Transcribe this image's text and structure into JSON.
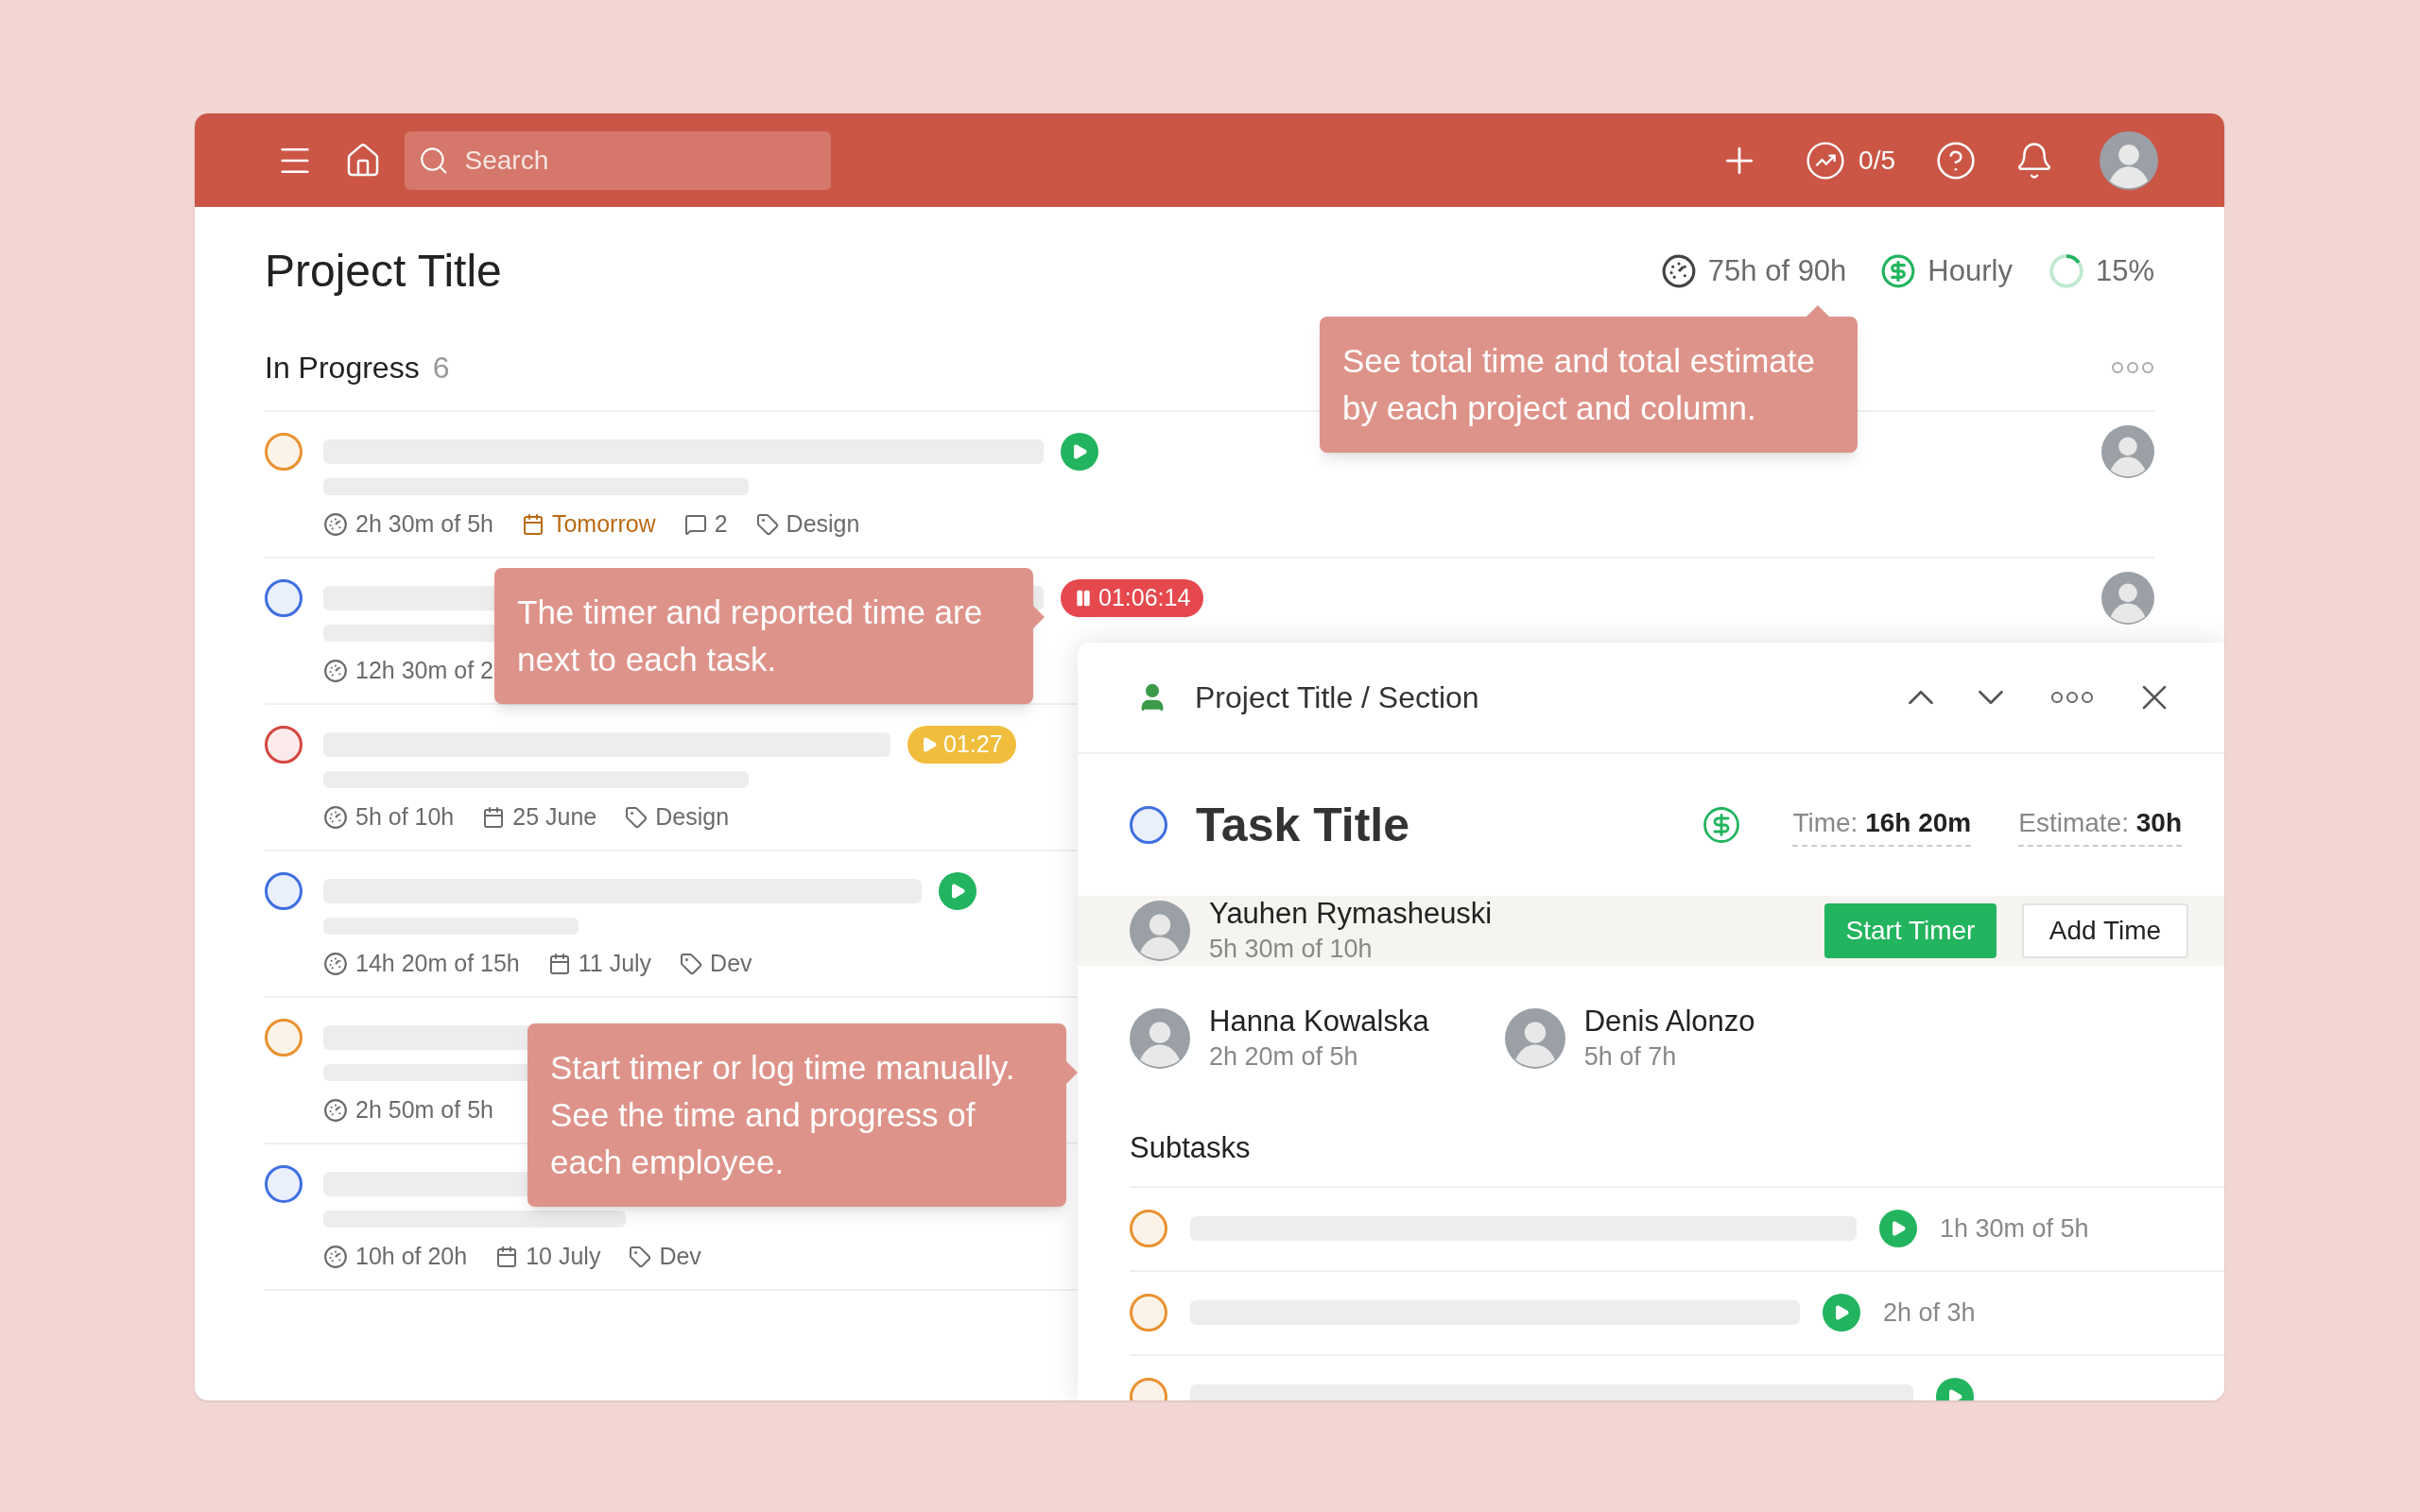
{
  "topbar": {
    "search": {
      "placeholder": "Search"
    },
    "goals": "0/5"
  },
  "project": {
    "title": "Project Title",
    "total_time": "75h of 90h",
    "billing": "Hourly",
    "progress": {
      "label": "15%",
      "level": 0.15
    }
  },
  "section": {
    "title": "In Progress",
    "count": "6"
  },
  "tasks": [
    {
      "color": "#e8922f",
      "timer": {
        "kind": "play"
      },
      "has_avatar": true,
      "meta": [
        {
          "kind": "time",
          "text": "2h 30m of 5h"
        },
        {
          "kind": "date",
          "text": "Tomorrow",
          "due_soon": true
        },
        {
          "kind": "comments",
          "text": "2"
        },
        {
          "kind": "tag",
          "text": "Design"
        }
      ]
    },
    {
      "color": "#3f6fe0",
      "timer": {
        "kind": "running",
        "time": "01:06:14"
      },
      "has_avatar": true,
      "meta": [
        {
          "kind": "time",
          "text": "12h 30m of 2"
        }
      ]
    },
    {
      "color": "#d4463f",
      "timer": {
        "kind": "paused",
        "time": "01:27"
      },
      "meta": [
        {
          "kind": "time",
          "text": "5h of 10h"
        },
        {
          "kind": "date",
          "text": "25 June",
          "due_soon": false
        },
        {
          "kind": "tag",
          "text": "Design"
        }
      ]
    },
    {
      "color": "#3f6fe0",
      "timer": {
        "kind": "play"
      },
      "meta": [
        {
          "kind": "time",
          "text": "14h 20m of 15h"
        },
        {
          "kind": "date",
          "text": "11 July",
          "due_soon": false
        },
        {
          "kind": "tag",
          "text": "Dev"
        }
      ]
    },
    {
      "color": "#e8922f",
      "meta": [
        {
          "kind": "time",
          "text": "2h 50m of 5h"
        }
      ]
    },
    {
      "color": "#3f6fe0",
      "meta": [
        {
          "kind": "time",
          "text": "10h of 20h"
        },
        {
          "kind": "date",
          "text": "10 July",
          "due_soon": false
        },
        {
          "kind": "tag",
          "text": "Dev"
        }
      ]
    }
  ],
  "panel": {
    "breadcrumb": "Project Title / Section",
    "task": {
      "title": "Task Title",
      "color": "#3f6fe0",
      "billable": true,
      "time_label": "Time:",
      "time": "16h 20m",
      "estimate_label": "Estimate:",
      "estimate": "30h"
    },
    "assignees": [
      {
        "name": "Yauhen Rymasheuski",
        "progress": "5h 30m of 10h",
        "selected": true
      },
      {
        "name": "Hanna Kowalska",
        "progress": "2h 20m of 5h",
        "selected": false
      },
      {
        "name": "Denis Alonzo",
        "progress": "5h of 7h",
        "selected": false
      }
    ],
    "actions": [
      "Start Timer",
      "Add Time"
    ],
    "subtasks_title": "Subtasks",
    "subtasks": [
      {
        "color": "#e8922f",
        "timer": {
          "kind": "play"
        },
        "time": "1h 30m of 5h"
      },
      {
        "color": "#e8922f",
        "timer": {
          "kind": "play"
        },
        "time": "2h of 3h"
      },
      {
        "color": "#e8922f",
        "timer": {
          "kind": "play"
        }
      }
    ]
  },
  "tips": [
    {
      "text": "See total time and total estimate by each project and column.",
      "kind": "up"
    },
    {
      "text": "The timer and reported time are next to each task.",
      "kind": "right"
    },
    {
      "text": "Start timer or log time manually. See the time and progress of each employee.",
      "kind": "right"
    }
  ]
}
